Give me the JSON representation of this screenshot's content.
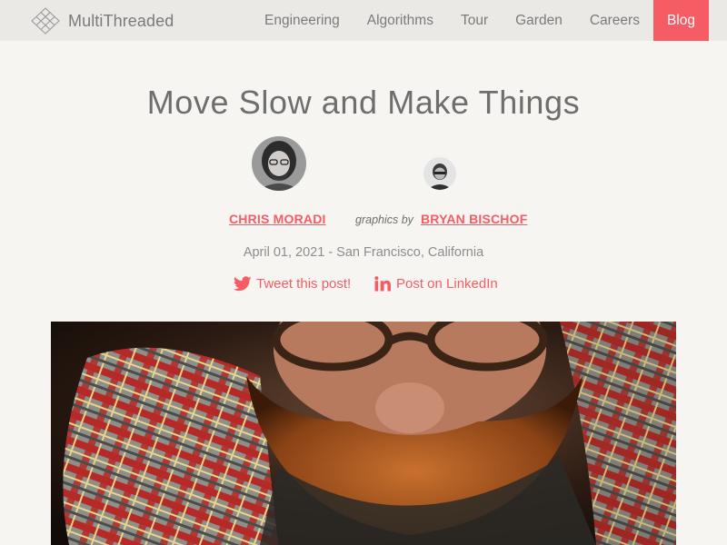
{
  "site": {
    "name": "MultiThreaded"
  },
  "nav": {
    "items": [
      {
        "label": "Engineering"
      },
      {
        "label": "Algorithms"
      },
      {
        "label": "Tour"
      },
      {
        "label": "Garden"
      },
      {
        "label": "Careers"
      },
      {
        "label": "Blog",
        "active": true
      }
    ]
  },
  "article": {
    "title": "Move Slow and Make Things",
    "author": "CHRIS MORADI",
    "graphics_label": "graphics by",
    "graphics_author": "BRYAN BISCHOF",
    "dateline": "April 01, 2021 - San Francisco, California"
  },
  "share": {
    "twitter_label": "Tweet this post!",
    "linkedin_label": "Post on LinkedIn"
  },
  "colors": {
    "accent": "#f65c64",
    "background": "#f6f5f2",
    "topbar": "#ebe9e6",
    "text": "#6e6e6e"
  },
  "icons": [
    "multithreaded-logo-icon",
    "twitter-icon",
    "linkedin-icon"
  ]
}
